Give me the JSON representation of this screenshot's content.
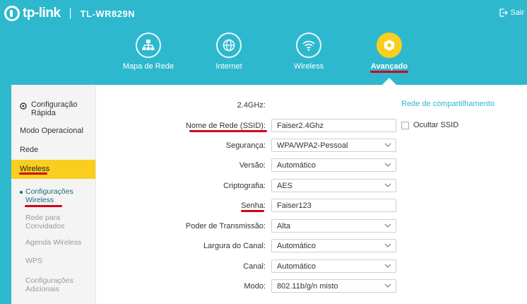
{
  "brand": {
    "logo_text": "tp-link",
    "separator": "|",
    "model": "TL-WR829N"
  },
  "header": {
    "logout_label": "Sair"
  },
  "nav": {
    "items": [
      {
        "label": "Mapa de Rede"
      },
      {
        "label": "Internet"
      },
      {
        "label": "Wireless"
      },
      {
        "label": "Avançado"
      }
    ],
    "active": "Avançado"
  },
  "sidebar": {
    "items": [
      {
        "label": "Configuração Rápida"
      },
      {
        "label": "Modo Operacional"
      },
      {
        "label": "Rede"
      },
      {
        "label": "Wireless"
      }
    ],
    "active": "Wireless",
    "subitems": [
      {
        "label": "Configurações Wireless"
      },
      {
        "label": "Rede para Convidados"
      },
      {
        "label": "Agenda Wireless"
      },
      {
        "label": "WPS"
      },
      {
        "label": "Configurações Adicionais"
      }
    ],
    "current_sub": "Configurações Wireless"
  },
  "form": {
    "band_label": "2.4GHz:",
    "ssid_label": "Nome de Rede (SSID):",
    "ssid_value": "Faiser2.4Ghz",
    "security_label": "Segurança:",
    "security_value": "WPA/WPA2-Pessoal",
    "version_label": "Versão:",
    "version_value": "Automático",
    "encryption_label": "Criptografia:",
    "encryption_value": "AES",
    "password_label": "Senha:",
    "password_value": "Faiser123",
    "tx_power_label": "Poder de Transmissão:",
    "tx_power_value": "Alta",
    "channel_width_label": "Largura do Canal:",
    "channel_width_value": "Automático",
    "channel_label": "Canal:",
    "channel_value": "Automático",
    "mode_label": "Modo:",
    "mode_value": "802.11b/g/n misto"
  },
  "side_options": {
    "share_network_link": "Rede de compartilhamento",
    "hide_ssid_label": "Ocultar SSID",
    "hide_ssid_checked": false
  },
  "colors": {
    "header": "#2db8ce",
    "accent": "#f9ce1f",
    "annotation": "#d0021b"
  }
}
